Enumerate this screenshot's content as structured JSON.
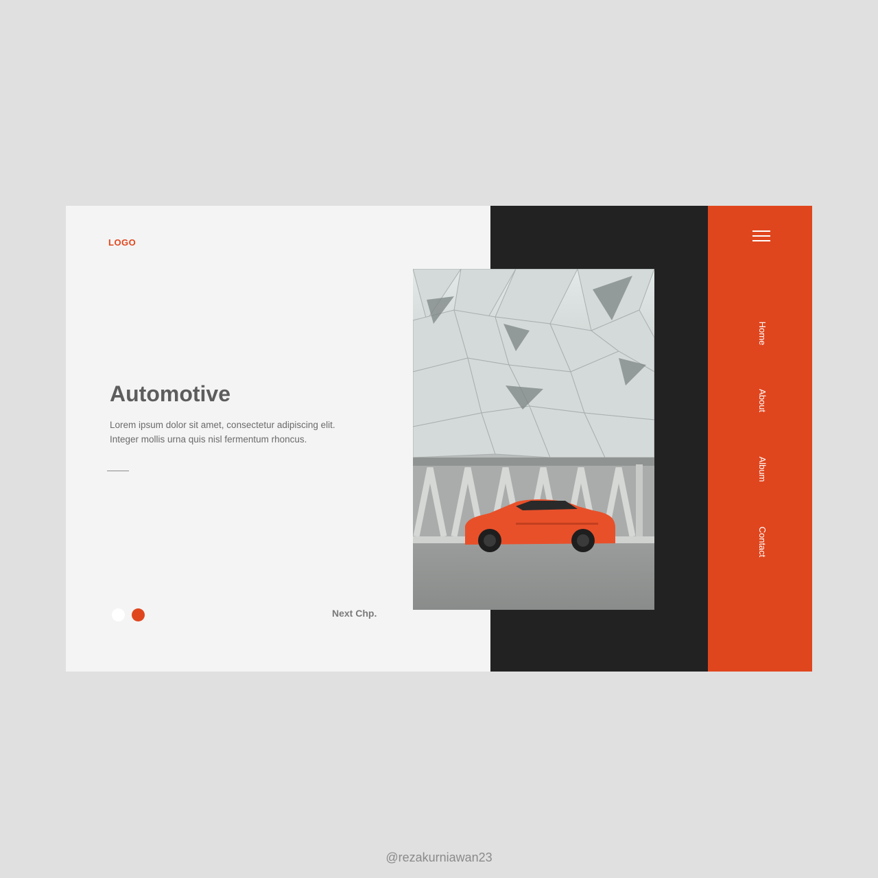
{
  "brand": {
    "logo_text": "LOGO"
  },
  "hero": {
    "title": "Automotive",
    "description": "Lorem ipsum dolor sit amet, consectetur adipiscing elit. Integer mollis urna quis nisl fermentum rhoncus."
  },
  "pagination": {
    "next_label": "Next Chp."
  },
  "sidebar": {
    "menu_icon": "hamburger-icon",
    "items": [
      {
        "label": "Home"
      },
      {
        "label": "About"
      },
      {
        "label": "Album"
      },
      {
        "label": "Contact"
      }
    ]
  },
  "photo": {
    "alt": "Orange sports car parked in front of a geometric building"
  },
  "credit": "@rezakurniawan23",
  "colors": {
    "accent": "#e0461e",
    "dark": "#222222",
    "light": "#f4f4f4",
    "background": "#e0e0e0"
  }
}
